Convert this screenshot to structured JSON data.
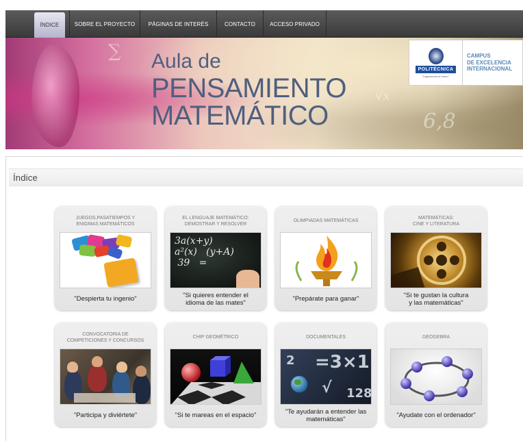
{
  "nav": {
    "items": [
      {
        "label": "ÍNDICE",
        "active": true
      },
      {
        "label": "SOBRE EL PROYECTO",
        "active": false
      },
      {
        "label": "PÁGINAS DE INTERÉS",
        "active": false
      },
      {
        "label": "CONTACTO",
        "active": false
      },
      {
        "label": "ACCESO PRIVADO",
        "active": false
      }
    ]
  },
  "banner": {
    "line1": "Aula de",
    "line2": "PENSAMIENTO",
    "line3": "MATEMÁTICO",
    "university": "POLITÉCNICA",
    "tagline": "\"Ingeniamos el futuro\"",
    "campus_line1": "CAMPUS",
    "campus_line2": "DE EXCELENCIA",
    "campus_line3": "INTERNACIONAL"
  },
  "section": {
    "title": "Índice"
  },
  "cards": [
    {
      "title": "JUEGOS,PASATIEMPOS Y\nENIGMAS MATEMÁTICOS",
      "caption": "\"Despierta tu ingenio\"",
      "icon": "puzzle-image"
    },
    {
      "title": "EL LENGUAJE MATEMÁTICO:\nDEMOSTRAR Y RESOLVER",
      "caption": "\"Si quieres entender el\nidioma de las mates\"",
      "icon": "chalkboard-image"
    },
    {
      "title": "OLIMPIADAS MATEMÁTICAS",
      "caption": "\"Prepárate para ganar\"",
      "icon": "olympic-flame-image"
    },
    {
      "title": "MATEMÁTICAS:\nCINE Y LITERATURA",
      "caption": "\"Si te gustan la cultura\ny las matemáticas\"",
      "icon": "film-reel-image"
    },
    {
      "title": "CONVOCATORIA DE\nCOMPETICIONES Y CONCURSOS",
      "caption": "\"Participa y diviértete\"",
      "icon": "students-image"
    },
    {
      "title": "CHIP GEOMÉTRICO",
      "caption": "\"Si te mareas en el espacio\"",
      "icon": "geometry-image"
    },
    {
      "title": "DOCUMENTALES",
      "caption": "\"Te ayudarán a entender las\nmatemáticas\"",
      "icon": "documentary-image"
    },
    {
      "title": "GEOGEBRA",
      "caption": "\"Ayudate con el ordenador\"",
      "icon": "geogebra-image"
    }
  ]
}
